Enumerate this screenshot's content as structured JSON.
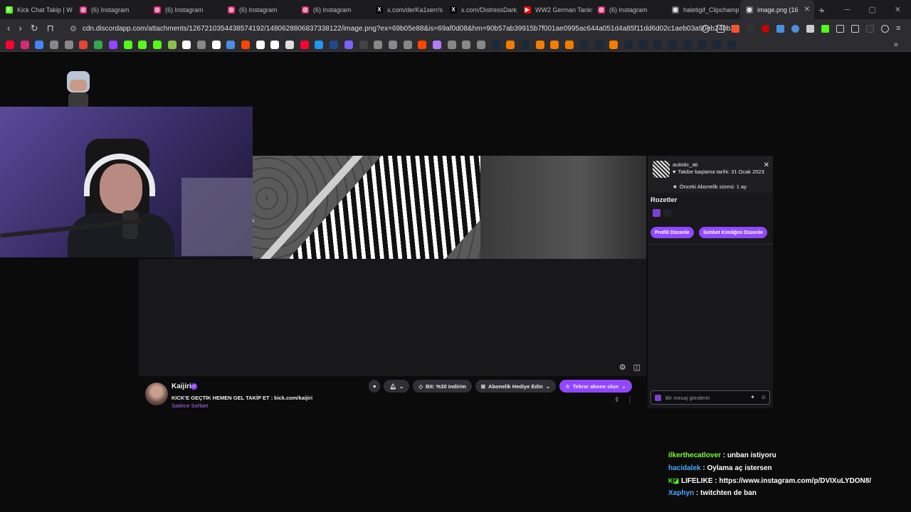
{
  "browser": {
    "tabs": [
      {
        "title": "Kick Chat Takip | W",
        "icon": "kick-icon",
        "color": "#53fc18",
        "glyph": "K"
      },
      {
        "title": "(6) Instagram",
        "icon": "instagram-icon",
        "color": "#d62976",
        "glyph": "◎"
      },
      {
        "title": "(6) Instagram",
        "icon": "instagram-icon",
        "color": "#d62976",
        "glyph": "◎"
      },
      {
        "title": "(6) Instagram",
        "icon": "instagram-icon",
        "color": "#d62976",
        "glyph": "◎"
      },
      {
        "title": "(6) Instagram",
        "icon": "instagram-icon",
        "color": "#d62976",
        "glyph": "◎"
      },
      {
        "title": "x.com/derKa1serr/s",
        "icon": "x-icon",
        "color": "#000000",
        "glyph": "X"
      },
      {
        "title": "x.com/DistressDark",
        "icon": "x-icon",
        "color": "#000000",
        "glyph": "X"
      },
      {
        "title": "WW2 German Tanks",
        "icon": "youtube-icon",
        "color": "#ff0000",
        "glyph": "▶"
      },
      {
        "title": "(6) Instagram",
        "icon": "instagram-icon",
        "color": "#d62976",
        "glyph": "◎"
      },
      {
        "title": "haletigif_Clipchamp",
        "icon": "globe-icon",
        "color": "#666666",
        "glyph": "◍"
      },
      {
        "title": "image.png (16",
        "icon": "globe-icon",
        "color": "#666666",
        "glyph": "◍",
        "active": true
      }
    ],
    "url": "cdn.discordapp.com/attachments/1267210354438574192/1480628806837338122/image.png?ex=69b05e88&is=69af0d08&hm=90b57ab39915b7f001ae0995ac644a051d4a85f11dd6d02c1aeb03a90eb240b3&",
    "bookmark_colors": [
      "#ff0033",
      "#d62976",
      "#4285f4",
      "#888",
      "#888",
      "#ea4335",
      "#34a853",
      "#9146ff",
      "#53fc18",
      "#53fc18",
      "#53fc18",
      "#8bc34a",
      "#ffffff",
      "#888",
      "#ffffff",
      "#4a90e2",
      "#ff4500",
      "#ffffff",
      "#ffffff",
      "#e0e0e0",
      "#ff0033",
      "#2196f3",
      "#1f4a8a",
      "#7b61ff",
      "#444",
      "#888",
      "#888",
      "#888",
      "#ff4500",
      "#b37bff",
      "#888",
      "#888",
      "#888",
      "#1b2838",
      "#f57c00",
      "#1b2838",
      "#f57c00",
      "#f57c00",
      "#f57c00",
      "#1b2838",
      "#1b2838",
      "#f57c00",
      "#1b2838",
      "#1b2838",
      "#1b2838",
      "#1b2838",
      "#1b2838",
      "#1b2838",
      "#1b2838",
      "#1b2838"
    ]
  },
  "stream": {
    "channel_name": "Kaijiri",
    "stream_title": "KICK'E GEÇTİK HEMEN GEL TAKİP ET : kick.com/kaijiri",
    "category": "Sadece Sohbet",
    "buttons": {
      "bits": "Bit: %30 indirim",
      "gift_sub": "Abonelik Hediye Edin",
      "resub": "Tekrar abone olun"
    }
  },
  "user_card": {
    "username": "autistic_ati",
    "follow_since": "Takibe başlama tarihi: 31 Ocak 2023",
    "prev_sub": "Önceki Abonelik süresi: 1 ay",
    "badges_title": "Rozetler",
    "edit_profile": "Profili Düzenle",
    "edit_chat_id": "Sohbet Kimliğini Düzenle",
    "chat_placeholder": "Bir mesaj gönderin"
  },
  "overlay_chat": [
    {
      "user": "ilkerthecatlover",
      "user_color": "#7dff3a",
      "message": "unban istiyoru"
    },
    {
      "user": "hacidalek",
      "user_color": "#4aa8ff",
      "message": "Oylama aç istersen"
    },
    {
      "user": "LIFELIKE",
      "user_color": "#ffffff",
      "message": "https://www.instagram.com/p/DVIXuLYDON8/",
      "badges": true
    },
    {
      "user": "Xaphyn",
      "user_color": "#4aa8ff",
      "message": "twitchten de ban"
    }
  ]
}
